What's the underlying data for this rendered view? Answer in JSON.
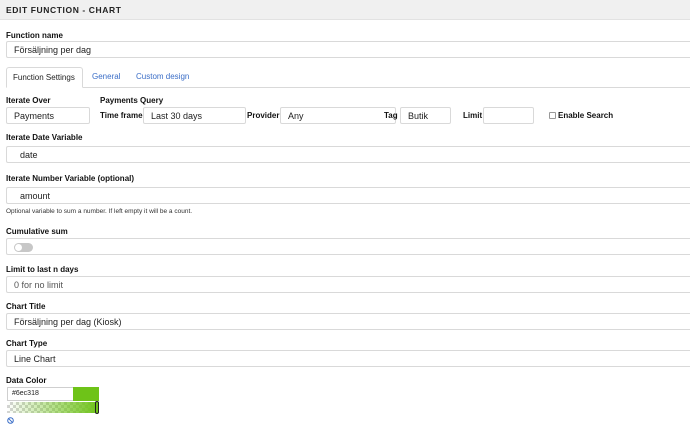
{
  "header": {
    "title": "EDIT FUNCTION - CHART"
  },
  "function_name": {
    "label": "Function name",
    "value": "Försäljning per dag"
  },
  "tabs": [
    {
      "label": "Function Settings",
      "active": true
    },
    {
      "label": "General",
      "active": false
    },
    {
      "label": "Custom design",
      "active": false
    }
  ],
  "iterate_over": {
    "label": "Iterate Over",
    "value": "Payments"
  },
  "payments_query": {
    "label": "Payments Query",
    "time_frame": {
      "label": "Time frame",
      "value": "Last 30 days"
    },
    "provider": {
      "label": "Provider",
      "value": "Any"
    },
    "tag": {
      "label": "Tag",
      "value": "Butik"
    },
    "limit": {
      "label": "Limit",
      "value": ""
    },
    "enable_search": {
      "label": "Enable Search",
      "checked": false
    }
  },
  "iterate_date_variable": {
    "label": "Iterate Date Variable",
    "value": "date"
  },
  "iterate_number_variable": {
    "label": "Iterate Number Variable (optional)",
    "value": "amount",
    "help": "Optional variable to sum a number. If left empty it will be a count."
  },
  "cumulative_sum": {
    "label": "Cumulative sum",
    "enabled": false
  },
  "limit_last_days": {
    "label": "Limit to last n days",
    "placeholder": "0 for no limit"
  },
  "chart_title": {
    "label": "Chart Title",
    "value": "Försäljning per dag (Kiosk)"
  },
  "chart_type": {
    "label": "Chart Type",
    "value": "Line Chart"
  },
  "data_color": {
    "label": "Data Color",
    "hex": "#6ec318",
    "alpha": 1.0
  },
  "icons": {
    "clear_color": "no-symbol-icon"
  },
  "colors": {
    "accent_link": "#3b6ec7",
    "data_color": "#6ec318",
    "toggle_off": "#c7c7c7"
  }
}
